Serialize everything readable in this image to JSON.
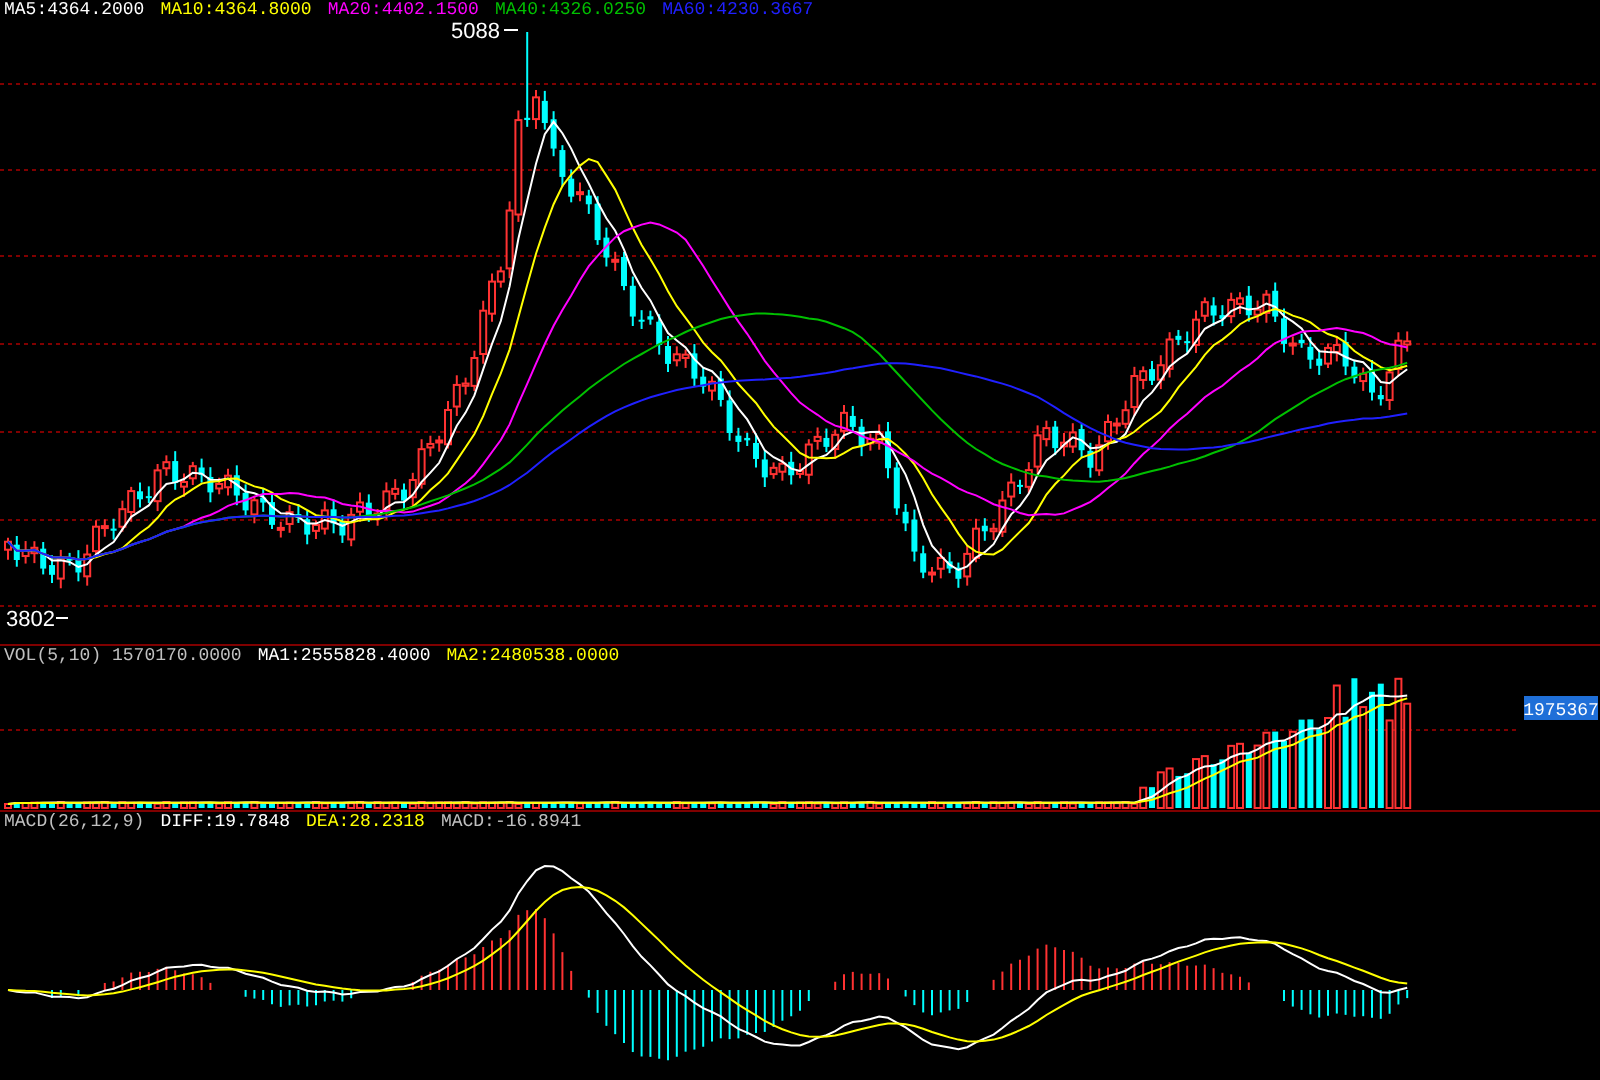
{
  "price_panel": {
    "legend": [
      {
        "text": "MA5:4364.2000",
        "color": "#ffffff"
      },
      {
        "text": "MA10:4364.8000",
        "color": "#ffff00"
      },
      {
        "text": "MA20:4402.1500",
        "color": "#ff00ff"
      },
      {
        "text": "MA40:4326.0250",
        "color": "#00c000"
      },
      {
        "text": "MA60:4230.3667",
        "color": "#2020ff"
      }
    ],
    "high_label": "5088",
    "low_label": "3802"
  },
  "volume_panel": {
    "legend": [
      {
        "text": "VOL(5,10) 1570170.0000",
        "color": "#c0c0c0"
      },
      {
        "text": "MA1:2555828.4000",
        "color": "#ffffff"
      },
      {
        "text": "MA2:2480538.0000",
        "color": "#ffff00"
      }
    ],
    "value_tag": "1975367"
  },
  "macd_panel": {
    "legend": [
      {
        "text": "MACD(26,12,9)",
        "color": "#c0c0c0"
      },
      {
        "text": "DIFF:19.7848",
        "color": "#ffffff"
      },
      {
        "text": "DEA:28.2318",
        "color": "#ffff00"
      },
      {
        "text": "MACD:-16.8941",
        "color": "#c0c0c0"
      }
    ]
  }
}
